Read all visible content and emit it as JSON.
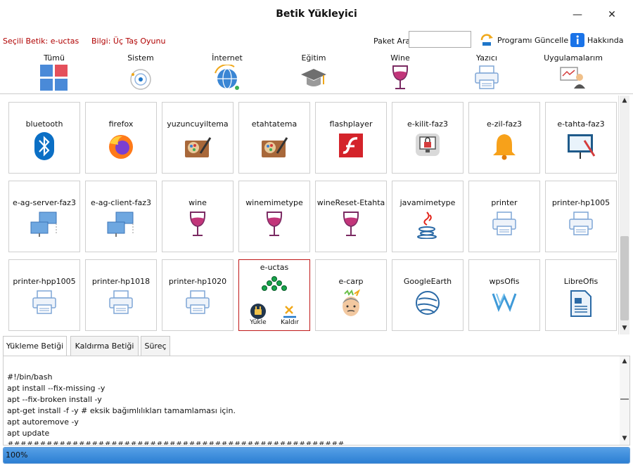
{
  "window": {
    "title": "Betik Yükleyici",
    "minimize_glyph": "—",
    "close_glyph": "✕"
  },
  "info": {
    "selected": "Seçili Betik: e-uctas",
    "detail": "Bilgi: Üç Taş Oyunu",
    "search_label": "Paket Ara",
    "search_value": "",
    "update_label": "Programı Güncelle",
    "about_label": "Hakkında"
  },
  "categories": [
    "Tümü",
    "Sistem",
    "İnternet",
    "Eğitim",
    "Wine",
    "Yazıcı",
    "Uygulamalarım"
  ],
  "tiles": [
    {
      "name": "bluetooth",
      "icon": "bluetooth-icon"
    },
    {
      "name": "firefox",
      "icon": "firefox-icon"
    },
    {
      "name": "yuzuncuyiltema",
      "icon": "paint-palette-icon"
    },
    {
      "name": "etahtatema",
      "icon": "paint-palette-icon"
    },
    {
      "name": "flashplayer",
      "icon": "flash-icon"
    },
    {
      "name": "e-kilit-faz3",
      "icon": "lock-screen-icon"
    },
    {
      "name": "e-zil-faz3",
      "icon": "bell-icon"
    },
    {
      "name": "e-tahta-faz3",
      "icon": "smartboard-icon"
    },
    {
      "name": "e-ag-server-faz3",
      "icon": "network-icon"
    },
    {
      "name": "e-ag-client-faz3",
      "icon": "network-icon"
    },
    {
      "name": "wine",
      "icon": "wine-icon"
    },
    {
      "name": "winemimetype",
      "icon": "wine-icon"
    },
    {
      "name": "wineReset-Etahta",
      "icon": "wine-icon"
    },
    {
      "name": "javamimetype",
      "icon": "java-icon"
    },
    {
      "name": "printer",
      "icon": "printer-icon"
    },
    {
      "name": "printer-hp1005",
      "icon": "printer-icon"
    },
    {
      "name": "printer-hpp1005",
      "icon": "printer-icon"
    },
    {
      "name": "printer-hp1018",
      "icon": "printer-icon"
    },
    {
      "name": "printer-hp1020",
      "icon": "printer-icon"
    },
    {
      "name": "e-uctas",
      "icon": "game-dots-icon",
      "install": "Yükle",
      "remove": "Kaldır"
    },
    {
      "name": "e-carp",
      "icon": "head-icon"
    },
    {
      "name": "GoogleEarth",
      "icon": "globe-icon"
    },
    {
      "name": "wpsOfis",
      "icon": "wps-icon"
    },
    {
      "name": "LibreOfis",
      "icon": "document-icon"
    }
  ],
  "tabs": [
    "Yükleme Betiği",
    "Kaldırma Betiği",
    "Süreç"
  ],
  "script_lines": [
    "#!/bin/bash",
    "apt install --fix-missing -y",
    "apt --fix-broken install -y",
    "apt-get install -f -y # eksik bağımlılıkları tamamlaması için.",
    "apt autoremove -y",
    "apt update",
    "####################################################"
  ],
  "progress": {
    "value": 1.0,
    "label": "100%"
  },
  "colors": {
    "selected_red": "#b00000",
    "progress_blue": "#2c7fd3",
    "wine_pink": "#c2357a",
    "info_blue": "#1a73e8"
  }
}
